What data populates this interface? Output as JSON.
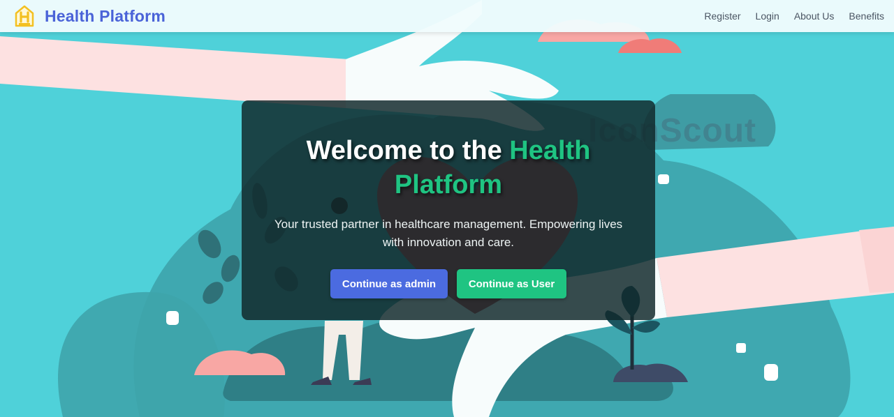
{
  "header": {
    "brand_name": "Health Platform",
    "logo_letter": "H",
    "nav": [
      {
        "label": "Register"
      },
      {
        "label": "Login"
      },
      {
        "label": "About Us"
      },
      {
        "label": "Benefits"
      }
    ]
  },
  "hero": {
    "title_part1": "Welcome to the ",
    "title_highlight": "Health Platform",
    "subtitle": "Your trusted partner in healthcare management. Empowering lives with innovation and care.",
    "admin_button": "Continue as admin",
    "user_button": "Continue as User"
  },
  "background": {
    "watermark_text": "IconScout"
  },
  "colors": {
    "brand": "#4a63d8",
    "accent_green": "#1fc482",
    "admin_button": "#4b6be0",
    "teal_bg": "#4fd1d9"
  }
}
